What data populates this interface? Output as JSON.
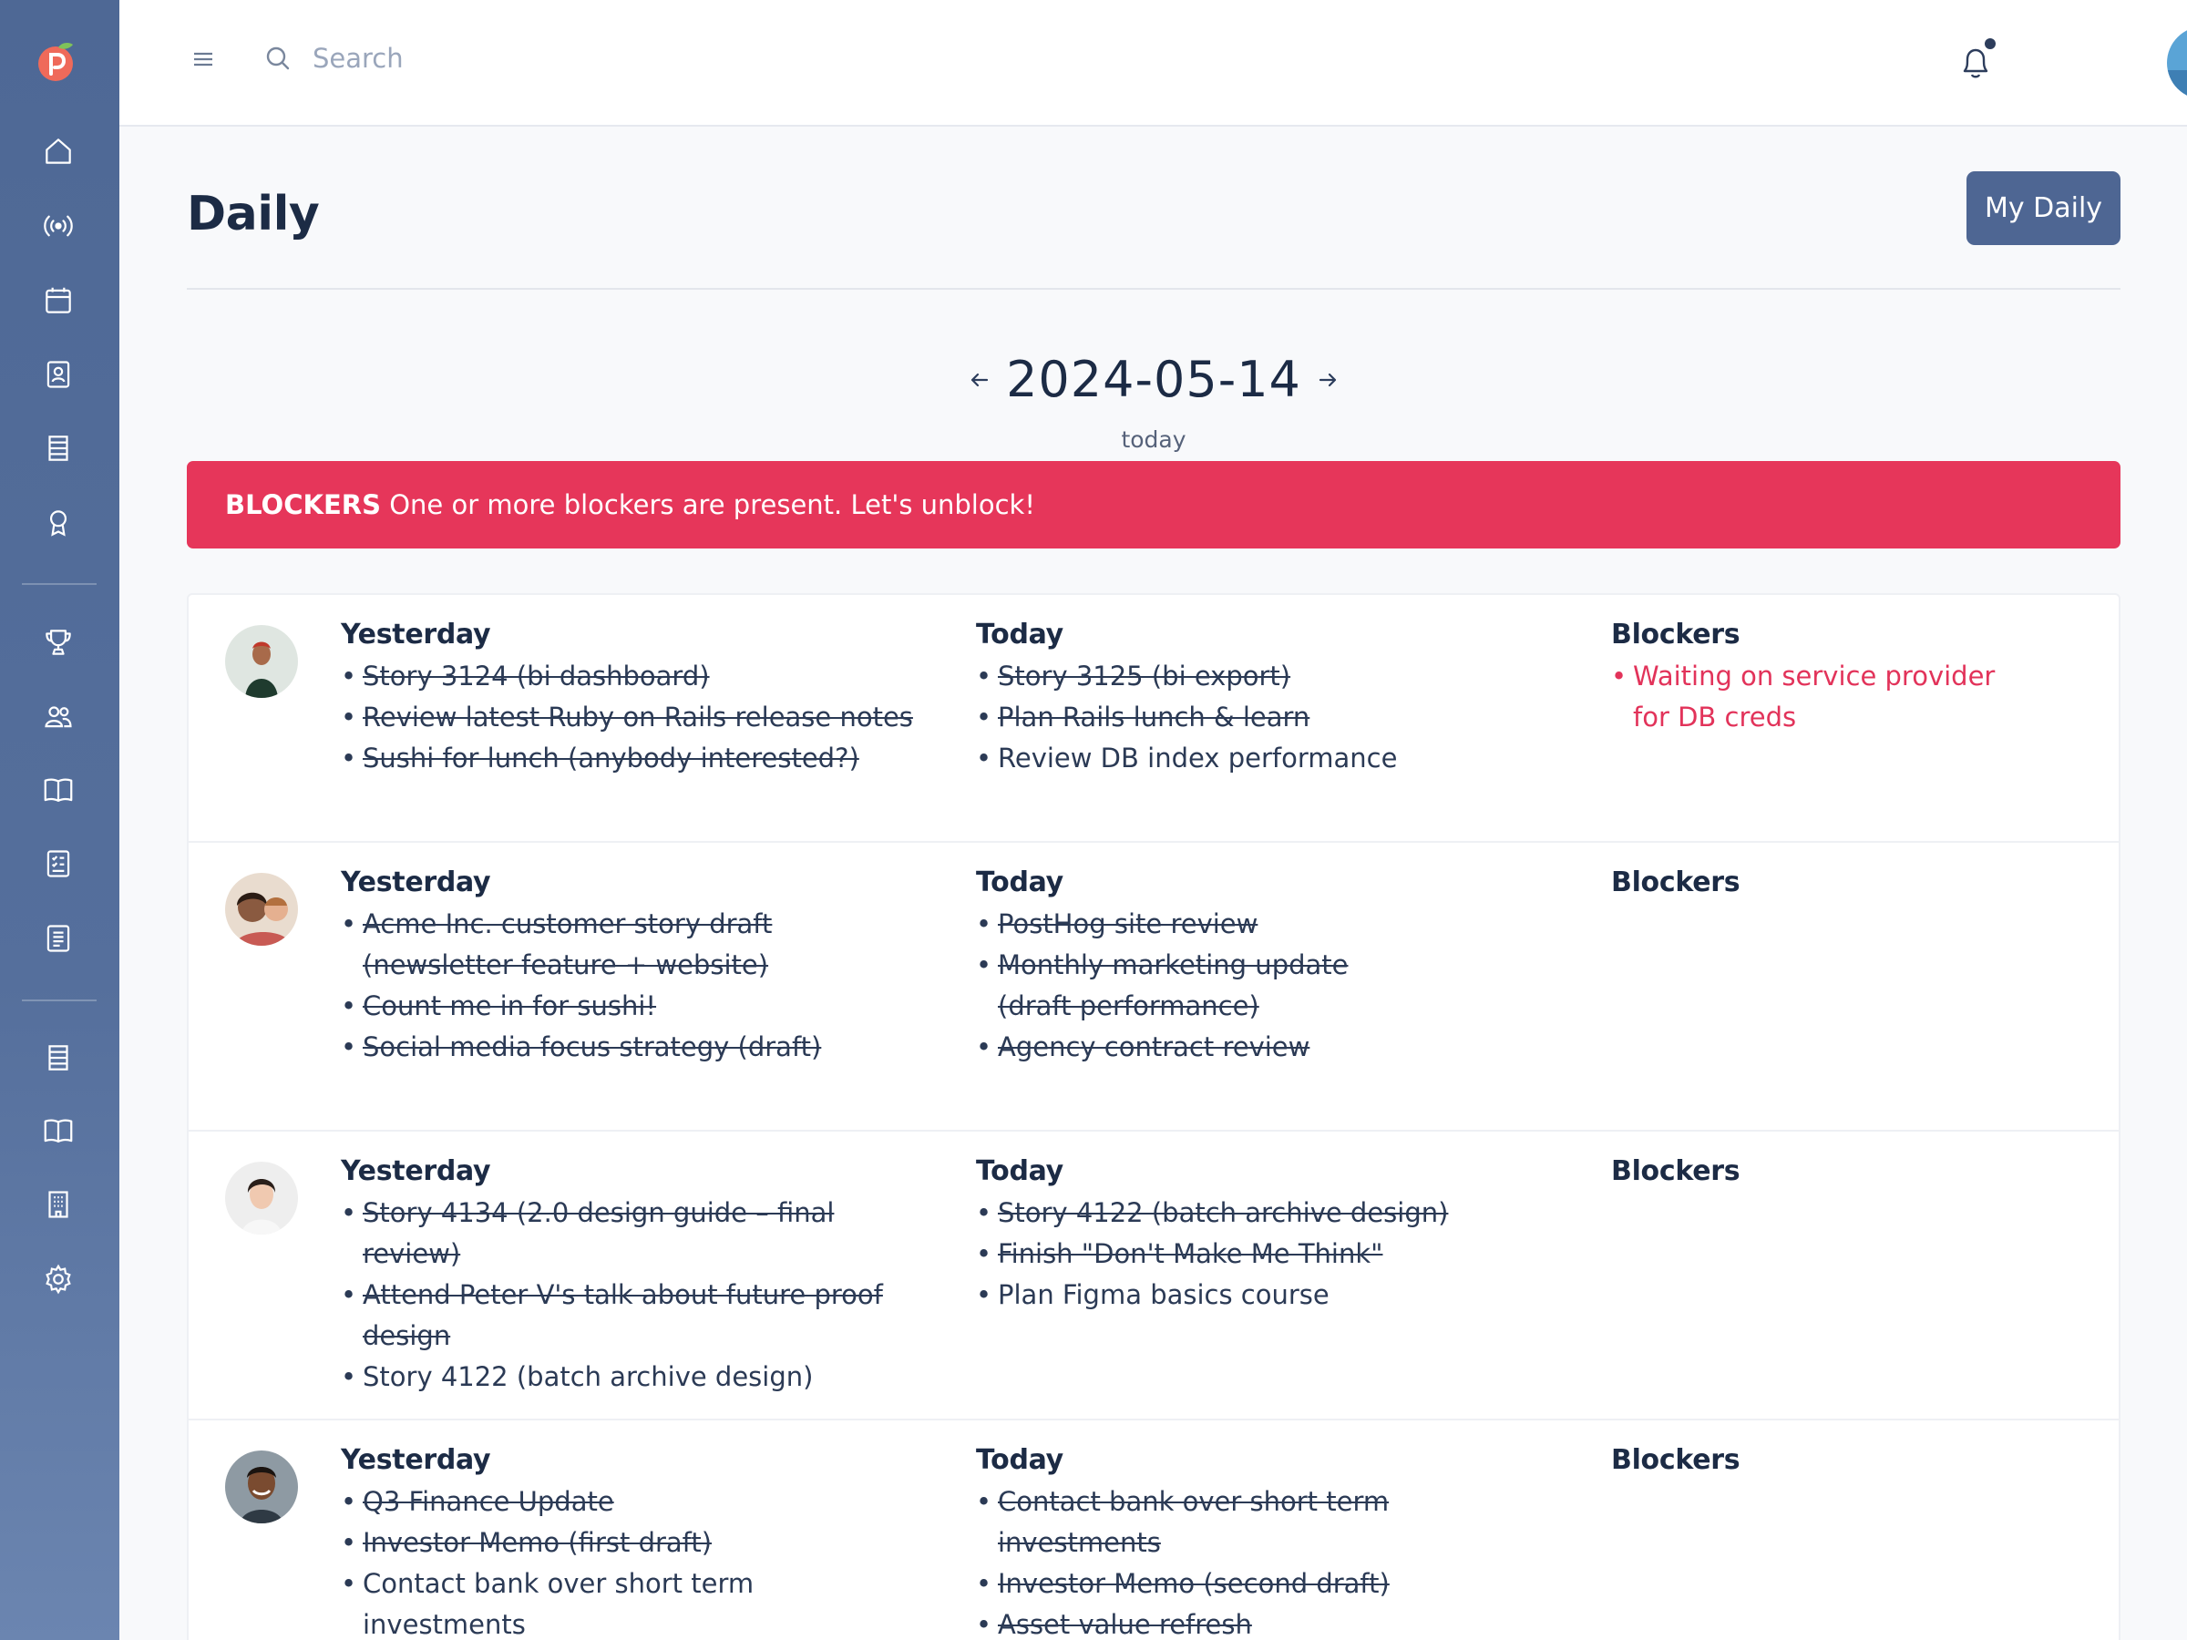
{
  "colors": {
    "sidebar": "#556f9c",
    "primary_button": "#4e6693",
    "alert": "#e6365a",
    "blocker_text": "#e2335a"
  },
  "sidebar": {
    "logo": "peach-logo",
    "items": [
      {
        "icon": "home-icon"
      },
      {
        "icon": "broadcast-icon"
      },
      {
        "icon": "calendar-icon"
      },
      {
        "icon": "contact-card-icon"
      },
      {
        "icon": "list-icon"
      },
      {
        "icon": "award-icon"
      },
      {
        "icon": "trophy-icon"
      },
      {
        "icon": "users-icon"
      },
      {
        "icon": "book-icon"
      },
      {
        "icon": "checklist-icon"
      },
      {
        "icon": "document-icon"
      },
      {
        "icon": "list-icon"
      },
      {
        "icon": "book-icon"
      },
      {
        "icon": "building-icon"
      },
      {
        "icon": "settings-icon"
      }
    ]
  },
  "topbar": {
    "search_placeholder": "Search"
  },
  "page": {
    "title": "Daily",
    "my_daily_button": "My Daily",
    "date": "2024-05-14",
    "date_sub": "today"
  },
  "alert": {
    "label": "BLOCKERS",
    "message": "One or more blockers are present. Let's unblock!"
  },
  "headers": {
    "yesterday": "Yesterday",
    "today": "Today",
    "blockers": "Blockers"
  },
  "entries": [
    {
      "yesterday": [
        {
          "text": "Story 3124 (bi dashboard)",
          "done": true
        },
        {
          "text": "Review latest Ruby on Rails release notes",
          "done": true
        },
        {
          "text": "Sushi for lunch (anybody interested?)",
          "done": true
        }
      ],
      "today": [
        {
          "text": "Story 3125 (bi export)",
          "done": true
        },
        {
          "text": "Plan Rails lunch & learn",
          "done": true
        },
        {
          "text": "Review DB index performance",
          "done": false
        }
      ],
      "blockers": [
        "Waiting on service provider for DB creds"
      ]
    },
    {
      "yesterday": [
        {
          "text": "Acme Inc. customer story draft (newsletter feature + website)",
          "done": true
        },
        {
          "text": "Count me in for sushi!",
          "done": true
        },
        {
          "text": "Social media focus strategy (draft)",
          "done": true
        }
      ],
      "today": [
        {
          "text": "PostHog site review",
          "done": true
        },
        {
          "text": "Monthly marketing update (draft performance)",
          "done": true
        },
        {
          "text": "Agency contract review",
          "done": true
        }
      ],
      "blockers": []
    },
    {
      "yesterday": [
        {
          "text": "Story 4134 (2.0 design guide – final review)",
          "done": true
        },
        {
          "text": "Attend Peter V's talk about future proof design",
          "done": true
        },
        {
          "text": "Story 4122 (batch archive design)",
          "done": false
        }
      ],
      "today": [
        {
          "text": "Story 4122 (batch archive design)",
          "done": true
        },
        {
          "text": "Finish \"Don't Make Me Think\"",
          "done": true
        },
        {
          "text": "Plan Figma basics course",
          "done": false
        }
      ],
      "blockers": []
    },
    {
      "yesterday": [
        {
          "text": "Q3 Finance Update",
          "done": true
        },
        {
          "text": "Investor Memo (first draft)",
          "done": true
        },
        {
          "text": "Contact bank over short term investments",
          "done": false
        }
      ],
      "today": [
        {
          "text": "Contact bank over short term investments",
          "done": true
        },
        {
          "text": "Investor Memo (second draft)",
          "done": true
        },
        {
          "text": "Asset value refresh",
          "done": true
        }
      ],
      "blockers": []
    }
  ]
}
